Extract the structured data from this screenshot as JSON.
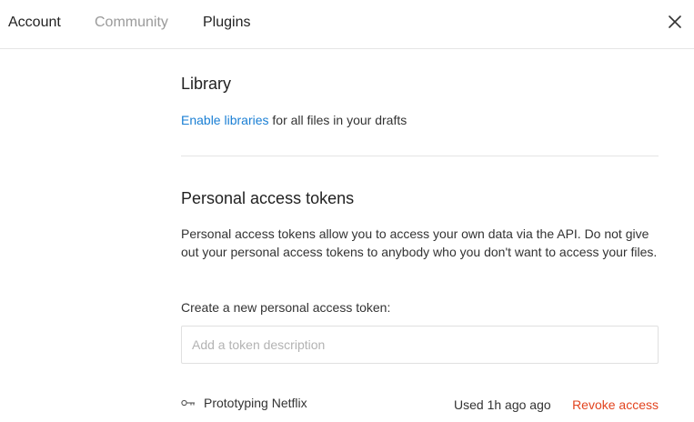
{
  "tabs": {
    "account": "Account",
    "community": "Community",
    "plugins": "Plugins"
  },
  "close_icon": "close-icon",
  "library": {
    "title": "Library",
    "link_text": "Enable libraries",
    "suffix": " for all files in your drafts"
  },
  "tokens": {
    "title": "Personal access tokens",
    "description": "Personal access tokens allow you to access your own data via the API. Do not give out your personal access tokens to anybody who you don't want to access your files.",
    "create_label": "Create a new personal access token:",
    "input_placeholder": "Add a token description",
    "input_value": "",
    "items": [
      {
        "icon": "key-icon",
        "name": "Prototyping Netflix",
        "used": "Used 1h ago ago",
        "revoke": "Revoke access"
      }
    ]
  },
  "colors": {
    "link": "#1a7fd4",
    "danger": "#e2441f",
    "muted_tab": "#9a9a9a"
  }
}
